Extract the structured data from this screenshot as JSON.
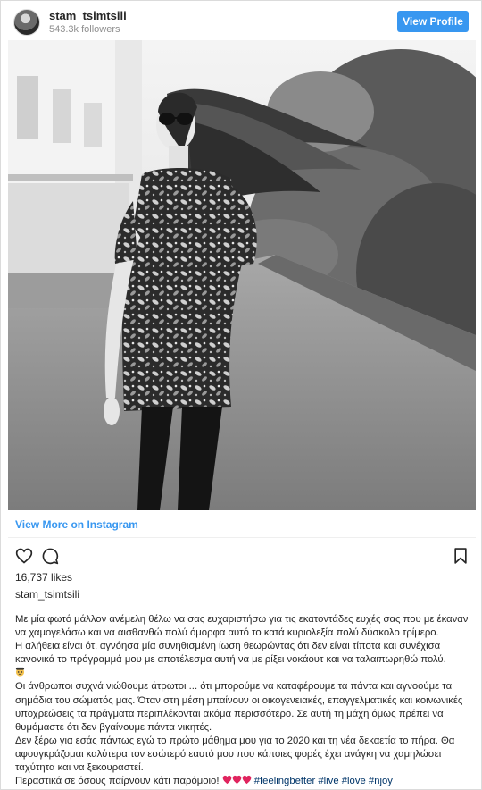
{
  "header": {
    "username": "stam_tsimtsili",
    "followers": "543.3k followers",
    "view_profile": "View Profile"
  },
  "photo": {
    "alt_icon": "post-photo"
  },
  "view_more": "View More on Instagram",
  "actions": {
    "like_icon": "heart-icon",
    "comment_icon": "comment-icon",
    "save_icon": "bookmark-icon"
  },
  "likes": "16,737 likes",
  "author": "stam_tsimtsili",
  "caption": {
    "p1": "Με μία φωτό μάλλον ανέμελη θέλω να σας ευχαριστήσω για τις εκατοντάδες ευχές σας που με έκαναν να χαμογελάσω και να αισθανθώ πολύ όμορφα αυτό το κατά κυριολεξία πολύ δύσκολο τρίμερο.",
    "p2": "Η αλήθεια είναι ότι αγνόησα μία συνηθισμένη ίωση θεωρώντας ότι δεν είναι τίποτα και συνέχισα κανονικά το πρόγραμμά μου με αποτέλεσμα αυτή να με ρίξει νοκάουτ και να ταλαιπωρηθώ πολύ.",
    "p3": "Οι άνθρωποι συχνά νιώθουμε άτρωτοι ... ότι μπορούμε να καταφέρουμε τα πάντα και αγνοούμε τα σημάδια του σώματός μας. Όταν στη μέση μπαίνουν οι οικογενειακές, επαγγελματικές και κοινωνικές υποχρεώσεις τα πράγματα περιπλέκονται ακόμα περισσότερο. Σε αυτή τη μάχη όμως πρέπει να θυμόμαστε ότι δεν βγαίνουμε πάντα νικητές.",
    "p4": "Δεν ξέρω για εσάς πάντως εγώ το πρώτο μάθημα μου για το 2020 και τη νέα δεκαετία το πήρα. Θα αφουγκράζομαι καλύτερα τον εσώτερό εαυτό μου που κάποιες φορές έχει ανάγκη να χαμηλώσει ταχύτητα και να ξεκουραστεί.",
    "p5": "Περαστικά σε όσους παίρνουν κάτι παρόμοιο!",
    "hashtags": [
      "#feelingbetter",
      "#live",
      "#love",
      "#njoy"
    ]
  },
  "colors": {
    "accent": "#3897f0",
    "text": "#262626",
    "muted": "#8e8e8e",
    "hashtag": "#003569",
    "heart_emoji": "#e0245e"
  }
}
